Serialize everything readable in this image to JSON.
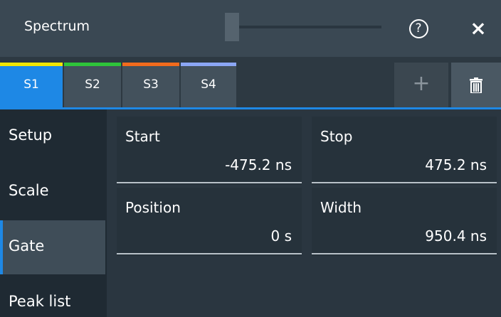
{
  "title_bar": {
    "title": "Spectrum",
    "help_label": "?",
    "close_label": "×"
  },
  "tabs": [
    {
      "label": "S1",
      "color": "#f2e600",
      "active": true
    },
    {
      "label": "S2",
      "color": "#2ec43a",
      "active": false
    },
    {
      "label": "S3",
      "color": "#f26b1d",
      "active": false
    },
    {
      "label": "S4",
      "color": "#8ba6f5",
      "active": false
    }
  ],
  "toolbar": {
    "add_label": "+"
  },
  "nav": {
    "items": [
      {
        "label": "Setup"
      },
      {
        "label": "Scale"
      },
      {
        "label": "Gate"
      },
      {
        "label": "Peak list"
      }
    ],
    "selected": "Gate"
  },
  "fields": {
    "start": {
      "label": "Start",
      "value": "-475.2 ns"
    },
    "stop": {
      "label": "Stop",
      "value": "475.2 ns"
    },
    "position": {
      "label": "Position",
      "value": "0 s"
    },
    "width": {
      "label": "Width",
      "value": "950.4 ns"
    }
  },
  "colors": {
    "accent": "#1e88e5"
  }
}
